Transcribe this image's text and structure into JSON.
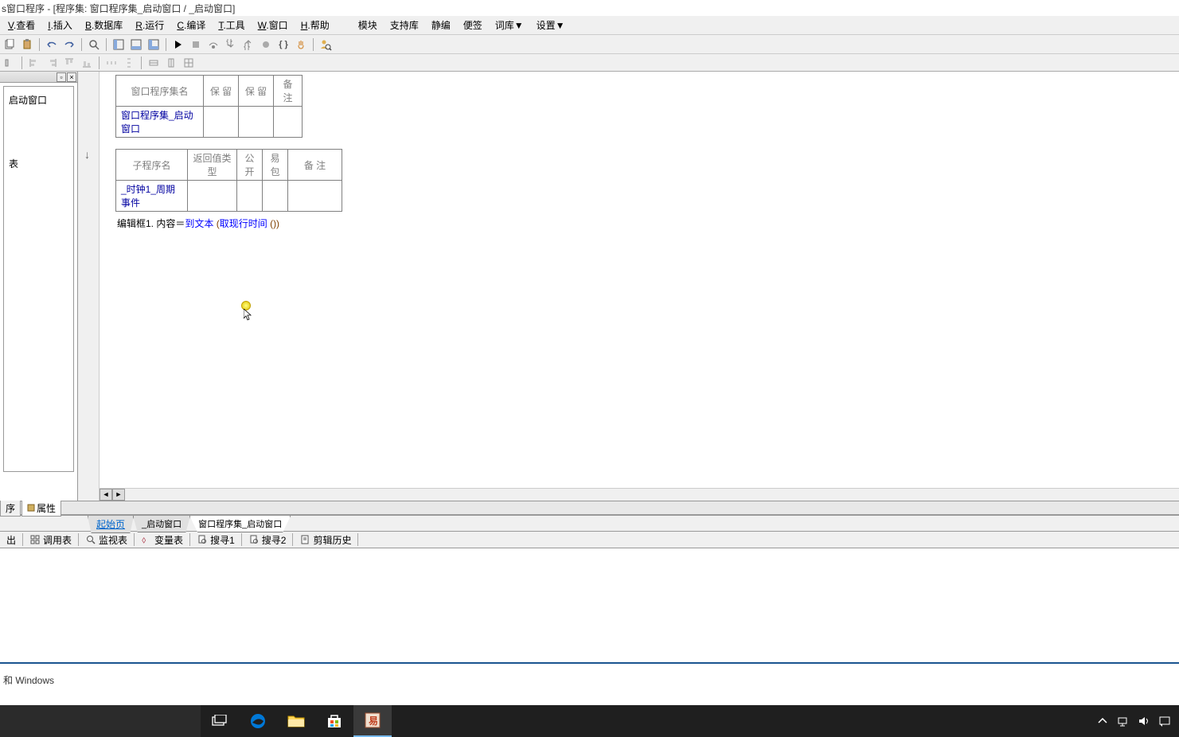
{
  "title": "s窗口程序 - [程序集: 窗口程序集_启动窗口 / _启动窗口]",
  "menu": {
    "view": "V.查看",
    "insert": "I.插入",
    "database": "B.数据库",
    "run": "R.运行",
    "compile": "C.编译",
    "tools": "T.工具",
    "window": "W.窗口",
    "help": "H.帮助",
    "modules": "模块",
    "support": "支持库",
    "static": "静编",
    "note": "便签",
    "dict": "词库▼",
    "settings": "设置▼"
  },
  "sidebar": {
    "item1": "启动窗口",
    "item2": "表"
  },
  "table1": {
    "h1": "窗口程序集名",
    "h2": "保 留",
    "h3": "保 留",
    "h4": "备 注",
    "v1": "窗口程序集_启动窗口"
  },
  "table2": {
    "h1": "子程序名",
    "h2": "返回值类型",
    "h3": "公开",
    "h4": "易包",
    "h5": "备 注",
    "v1": "_时钟1_周期事件"
  },
  "codeline": {
    "part1": "编辑框1. 内容",
    "part2": "＝",
    "part3": "到文本",
    "part4": " (",
    "part5": "取现行时间",
    "part6": " ())"
  },
  "proptabs": {
    "t1": "序",
    "t2": "属性"
  },
  "bottomtabs": {
    "t1": "起始页",
    "t2": "_启动窗口",
    "t3": "窗口程序集_启动窗口"
  },
  "tooltabs": {
    "t1": "出",
    "t2": "调用表",
    "t3": "监视表",
    "t4": "变量表",
    "t5": "搜寻1",
    "t6": "搜寻2",
    "t7": "剪辑历史"
  },
  "status": "和 Windows",
  "taskbar": {
    "search": ""
  }
}
